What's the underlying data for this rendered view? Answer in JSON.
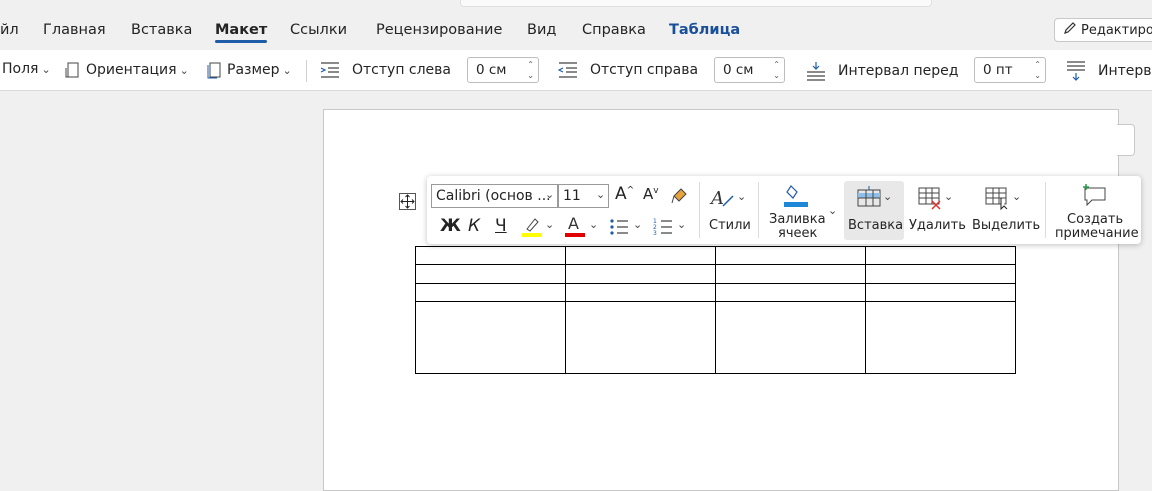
{
  "tabs": [
    {
      "label": "йл",
      "active": false
    },
    {
      "label": "Главная",
      "active": false
    },
    {
      "label": "Вставка",
      "active": false
    },
    {
      "label": "Макет",
      "active": true
    },
    {
      "label": "Ссылки",
      "active": false
    },
    {
      "label": "Рецензирование",
      "active": false
    },
    {
      "label": "Вид",
      "active": false
    },
    {
      "label": "Справка",
      "active": false
    },
    {
      "label": "Таблица",
      "active": false,
      "contextual": true
    }
  ],
  "edit_button": {
    "label": "Редактирование",
    "icon": "pencil-icon"
  },
  "ribbon": {
    "fields_label": "Поля",
    "orientation_label": "Ориентация",
    "size_label": "Размер",
    "indent_left_label": "Отступ слева",
    "indent_left_value": "0 см",
    "indent_right_label": "Отступ справа",
    "indent_right_value": "0 см",
    "spacing_before_label": "Интервал перед",
    "spacing_before_value": "0 пт",
    "spacing_after_label": "Интерв"
  },
  "floatbar": {
    "font_name": "Calibri (основ ...",
    "font_size": "11",
    "bold": "Ж",
    "italic": "К",
    "underline": "Ч",
    "styles_label": "Стили",
    "shading_label_1": "Заливка",
    "shading_label_2": "ячеек",
    "insert_label": "Вставка",
    "delete_label": "Удалить",
    "select_label": "Выделить",
    "comment_label_1": "Создать",
    "comment_label_2": "примечание",
    "highlight_color": "#ffff00",
    "font_color": "#e00000",
    "shading_color": "#1e88d8"
  },
  "table": {
    "rows": 4,
    "cols": 4
  }
}
